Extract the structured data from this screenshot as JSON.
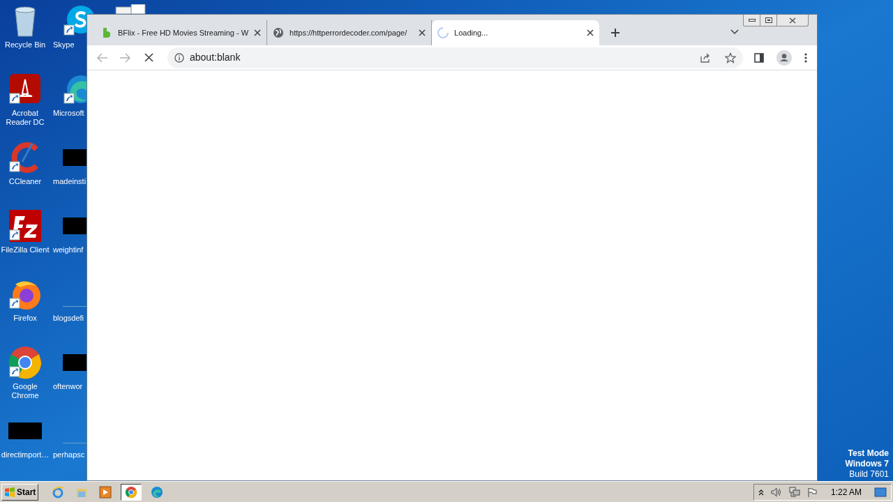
{
  "desktop_icon_columns": [
    {
      "icons": [
        {
          "label": "Recycle Bin",
          "kind": "recycle"
        },
        {
          "label": "Acrobat Reader DC",
          "kind": "acrobat"
        },
        {
          "label": "CCleaner",
          "kind": "ccleaner"
        },
        {
          "label": "FileZilla Client",
          "kind": "filezilla"
        },
        {
          "label": "Firefox",
          "kind": "firefox"
        },
        {
          "label": "Google Chrome",
          "kind": "chrome"
        },
        {
          "label": "directimport…",
          "kind": "redacted"
        }
      ]
    },
    {
      "icons": [
        {
          "label": "Skype",
          "kind": "skype"
        },
        {
          "label": "Microsoft",
          "kind": "edge"
        },
        {
          "label": "madeinsti",
          "kind": "redacted"
        },
        {
          "label": "weightinf",
          "kind": "redacted"
        },
        {
          "label": "blogsdefi",
          "kind": "blank"
        },
        {
          "label": "oftenwor",
          "kind": "redacted"
        },
        {
          "label": "perhapsc",
          "kind": "blank"
        }
      ]
    }
  ],
  "browser": {
    "tabs": [
      {
        "title": "BFlix - Free HD Movies Streaming - W",
        "kind": "favicon",
        "selected": false
      },
      {
        "title": "https://httperrordecoder.com/page/",
        "kind": "globe",
        "selected": false
      },
      {
        "title": "Loading...",
        "kind": "spinner",
        "selected": true
      }
    ],
    "address": "about:blank"
  },
  "os_notice": [
    "Test Mode",
    "Windows 7",
    "Build 7601"
  ],
  "taskbar": {
    "start": "Start",
    "apps": [
      {
        "kind": "ie",
        "selected": false
      },
      {
        "kind": "explorer",
        "selected": false
      },
      {
        "kind": "media",
        "selected": false
      },
      {
        "kind": "chrome",
        "selected": true
      },
      {
        "kind": "edge",
        "selected": false
      }
    ],
    "clock": "1:22 AM"
  }
}
